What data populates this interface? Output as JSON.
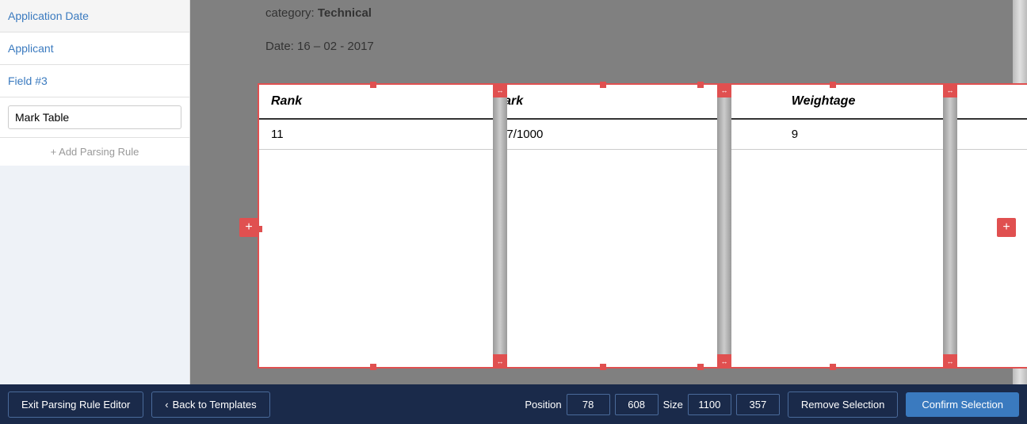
{
  "sidebar": {
    "items": [
      {
        "label": "Application Date"
      },
      {
        "label": "Applicant"
      },
      {
        "label": "Field #3"
      }
    ],
    "input_value": "Mark Table",
    "add_rule_label": "+ Add Parsing Rule"
  },
  "document": {
    "category_label": "category:",
    "category_value": "Technical",
    "date_label": "Date: 16 – 02 - 2017",
    "table": {
      "columns": [
        "Rank",
        "Mark",
        "Weightage"
      ],
      "rows": [
        [
          "11",
          "927/1000",
          "9"
        ]
      ]
    }
  },
  "footer": {
    "exit_label": "Exit Parsing Rule Editor",
    "back_label": "Back to Templates",
    "position_label": "Position",
    "position_x": "78",
    "position_y": "608",
    "size_label": "Size",
    "size_w": "1100",
    "size_h": "357",
    "remove_label": "Remove Selection",
    "confirm_label": "Confirm Selection"
  },
  "icons": {
    "arrow_left": "‹",
    "arrow_h": "↔",
    "plus": "+"
  }
}
